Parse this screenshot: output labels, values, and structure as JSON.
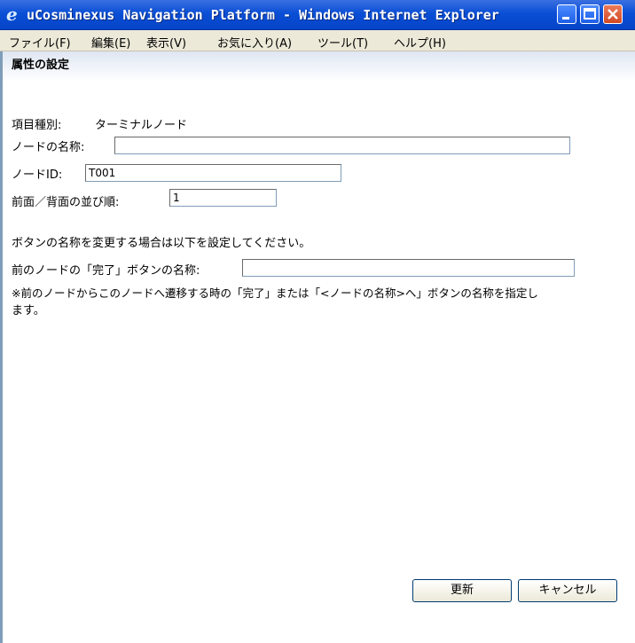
{
  "window": {
    "title": "uCosminexus Navigation Platform - Windows Internet Explorer"
  },
  "menu": {
    "items": [
      "ファイル(F)",
      "編集(E)",
      "表示(V)",
      "お気に入り(A)",
      "ツール(T)",
      "ヘルプ(H)"
    ]
  },
  "panel": {
    "title": "属性の設定"
  },
  "form": {
    "item_type_label": "項目種別:",
    "item_type_value": "ターミナルノード",
    "node_name_label": "ノードの名称:",
    "node_name_value": "",
    "node_id_label": "ノードID:",
    "node_id_value": "T001",
    "order_label": "前面／背面の並び順:",
    "order_value": "1",
    "instruction": "ボタンの名称を変更する場合は以下を設定してください。",
    "prev_button_label": "前のノードの「完了」ボタンの名称:",
    "prev_button_value": "",
    "note_line1": "※前のノードからこのノードへ遷移する時の「完了」または「<ノードの名称>へ」ボタンの名称を指定し",
    "note_line2": "ます。"
  },
  "buttons": {
    "update": "更新",
    "cancel": "キャンセル"
  },
  "icons": {
    "app": "ie-icon",
    "minimize": "minimize-icon",
    "maximize": "maximize-icon",
    "close": "close-icon"
  },
  "colors": {
    "titlebar": "#0a4fd6",
    "menubar": "#ece9d8",
    "close_button": "#d24a24"
  }
}
